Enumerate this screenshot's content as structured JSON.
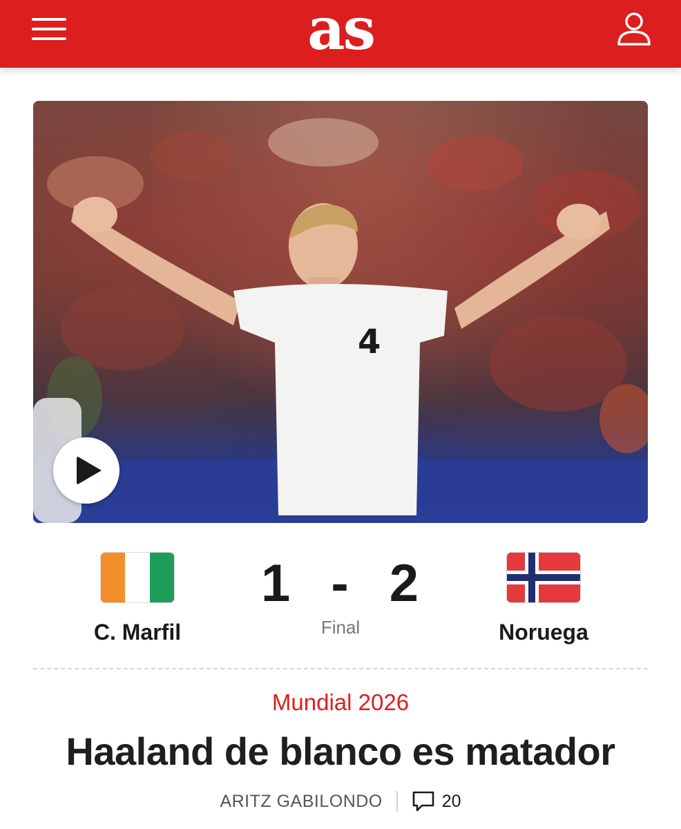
{
  "header": {
    "logo_text": "as",
    "brand_color": "#dc1e1e",
    "menu_icon": "hamburger-icon",
    "user_icon": "user-icon"
  },
  "hero": {
    "media_type": "video",
    "play_icon": "play-icon"
  },
  "match": {
    "home_team": "C. Marfil",
    "away_team": "Noruega",
    "home_score": "1",
    "separator": "-",
    "away_score": "2",
    "status": "Final"
  },
  "article": {
    "section": "Mundial 2026",
    "headline": "Haaland de blanco es matador",
    "author": "ARITZ GABILONDO",
    "comment_icon": "comment-icon",
    "comment_count": "20"
  }
}
